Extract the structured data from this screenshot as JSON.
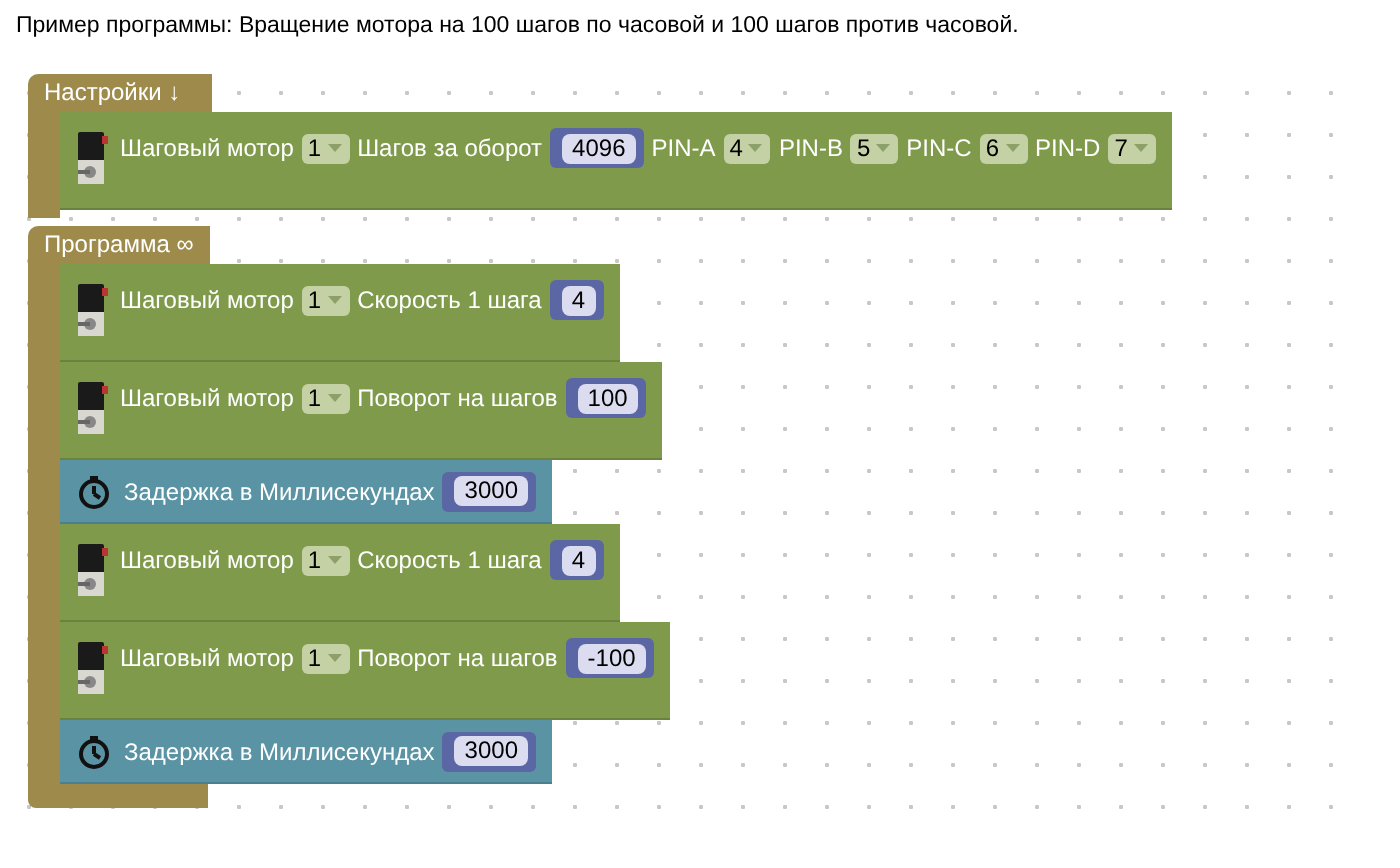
{
  "caption": "Пример программы: Вращение мотора на 100 шагов по часовой и 100 шагов против часовой.",
  "groups": [
    {
      "title": "Настройки ↓",
      "blocks": [
        {
          "kind": "motor",
          "parts": [
            {
              "kind": "text",
              "text": "Шаговый мотор"
            },
            {
              "kind": "dropdown",
              "text": "1"
            },
            {
              "kind": "text",
              "text": "Шагов за оборот"
            },
            {
              "kind": "number",
              "text": "4096"
            },
            {
              "kind": "text",
              "text": "PIN-A"
            },
            {
              "kind": "dropdown",
              "text": "4"
            },
            {
              "kind": "text",
              "text": "PIN-B"
            },
            {
              "kind": "dropdown",
              "text": "5"
            },
            {
              "kind": "text",
              "text": "PIN-C"
            },
            {
              "kind": "dropdown",
              "text": "6"
            },
            {
              "kind": "text",
              "text": "PIN-D"
            },
            {
              "kind": "dropdown",
              "text": "7"
            }
          ]
        }
      ]
    },
    {
      "title": "Программа ∞",
      "blocks": [
        {
          "kind": "motor",
          "parts": [
            {
              "kind": "text",
              "text": "Шаговый мотор"
            },
            {
              "kind": "dropdown",
              "text": "1"
            },
            {
              "kind": "text",
              "text": "Скорость 1 шага"
            },
            {
              "kind": "number",
              "text": "4"
            }
          ]
        },
        {
          "kind": "motor",
          "parts": [
            {
              "kind": "text",
              "text": "Шаговый мотор"
            },
            {
              "kind": "dropdown",
              "text": "1"
            },
            {
              "kind": "text",
              "text": "Поворот на шагов"
            },
            {
              "kind": "number",
              "text": "100"
            }
          ]
        },
        {
          "kind": "delay",
          "parts": [
            {
              "kind": "text",
              "text": "Задержка в Миллисекундах"
            },
            {
              "kind": "number",
              "text": "3000"
            }
          ]
        },
        {
          "kind": "motor",
          "parts": [
            {
              "kind": "text",
              "text": "Шаговый мотор"
            },
            {
              "kind": "dropdown",
              "text": "1"
            },
            {
              "kind": "text",
              "text": "Скорость 1 шага"
            },
            {
              "kind": "number",
              "text": "4"
            }
          ]
        },
        {
          "kind": "motor",
          "parts": [
            {
              "kind": "text",
              "text": "Шаговый мотор"
            },
            {
              "kind": "dropdown",
              "text": "1"
            },
            {
              "kind": "text",
              "text": "Поворот на шагов"
            },
            {
              "kind": "number",
              "text": "-100"
            }
          ]
        },
        {
          "kind": "delay",
          "parts": [
            {
              "kind": "text",
              "text": "Задержка в Миллисекундах"
            },
            {
              "kind": "number",
              "text": "3000"
            }
          ]
        }
      ]
    }
  ]
}
